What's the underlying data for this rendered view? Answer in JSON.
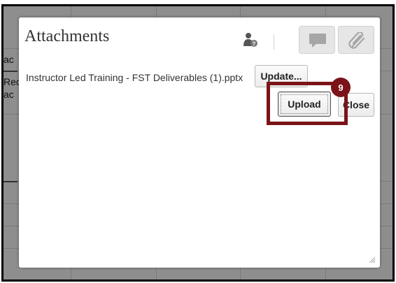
{
  "background": {
    "text_fragments": [
      "ac",
      "Rec",
      "ac"
    ]
  },
  "dialog": {
    "title": "Attachments",
    "toolbar": {
      "person_icon": "person-help-icon",
      "comment_icon": "comment-icon",
      "attach_icon": "paperclip-icon"
    },
    "file_name": "Instructor Led Training - FST Deliverables (1).pptx",
    "update_label": "Update...",
    "upload_label": "Upload",
    "close_label": "Close"
  },
  "callout": {
    "step": "9",
    "color": "#7b1418"
  }
}
